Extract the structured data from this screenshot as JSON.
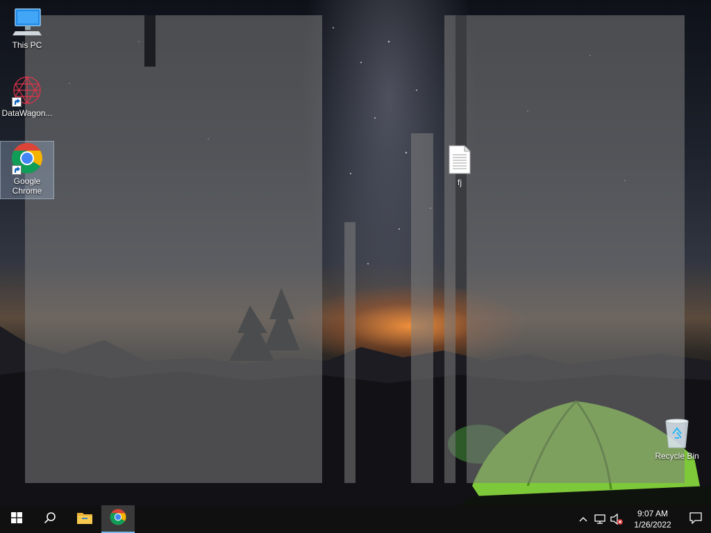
{
  "desktop": {
    "icons": [
      {
        "label": "This PC",
        "icon": "computer-icon"
      },
      {
        "label": "DataWagon...",
        "icon": "datawagon-icon"
      },
      {
        "label": "Google Chrome",
        "icon": "chrome-icon"
      },
      {
        "label": "fj",
        "icon": "text-file-icon"
      },
      {
        "label": "Recycle Bin",
        "icon": "recycle-bin-icon"
      }
    ]
  },
  "taskbar": {
    "start": {
      "icon": "windows-logo-icon"
    },
    "search": {
      "icon": "search-icon"
    },
    "pinned": [
      {
        "name": "File Explorer",
        "icon": "folder-icon"
      },
      {
        "name": "Google Chrome",
        "icon": "chrome-icon",
        "active": true
      }
    ],
    "tray": {
      "icons": [
        "chevron-up-icon",
        "network-icon",
        "volume-muted-icon"
      ],
      "time": "9:07 AM",
      "date": "1/26/2022",
      "notification_icon": "action-center-icon"
    }
  },
  "colors": {
    "taskbar_bg": "#101010",
    "active_indicator": "#76b9ed",
    "overlay": "#7d7d7d"
  }
}
